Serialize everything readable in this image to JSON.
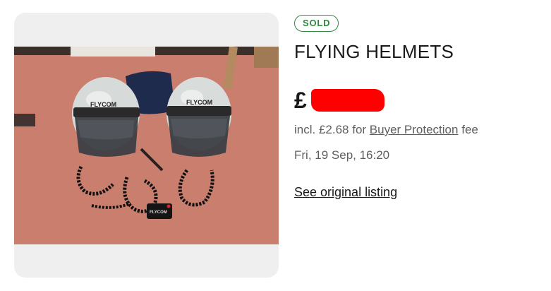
{
  "listing": {
    "status_badge": "SOLD",
    "title": "FLYING HELMETS",
    "price_currency": "£",
    "fee_prefix": "incl. £2.68 for",
    "fee_link": "Buyer Protection",
    "fee_suffix": "fee",
    "sold_date": "Fri, 19 Sep, 16:20",
    "see_original_link": "See original listing",
    "photo_brand_text": "FLYCOM"
  },
  "colors": {
    "sold_green": "#2e8a3f",
    "redaction_red": "#ff0000",
    "muted_text": "#5e5e5e",
    "carpet": "#c87a6c"
  }
}
